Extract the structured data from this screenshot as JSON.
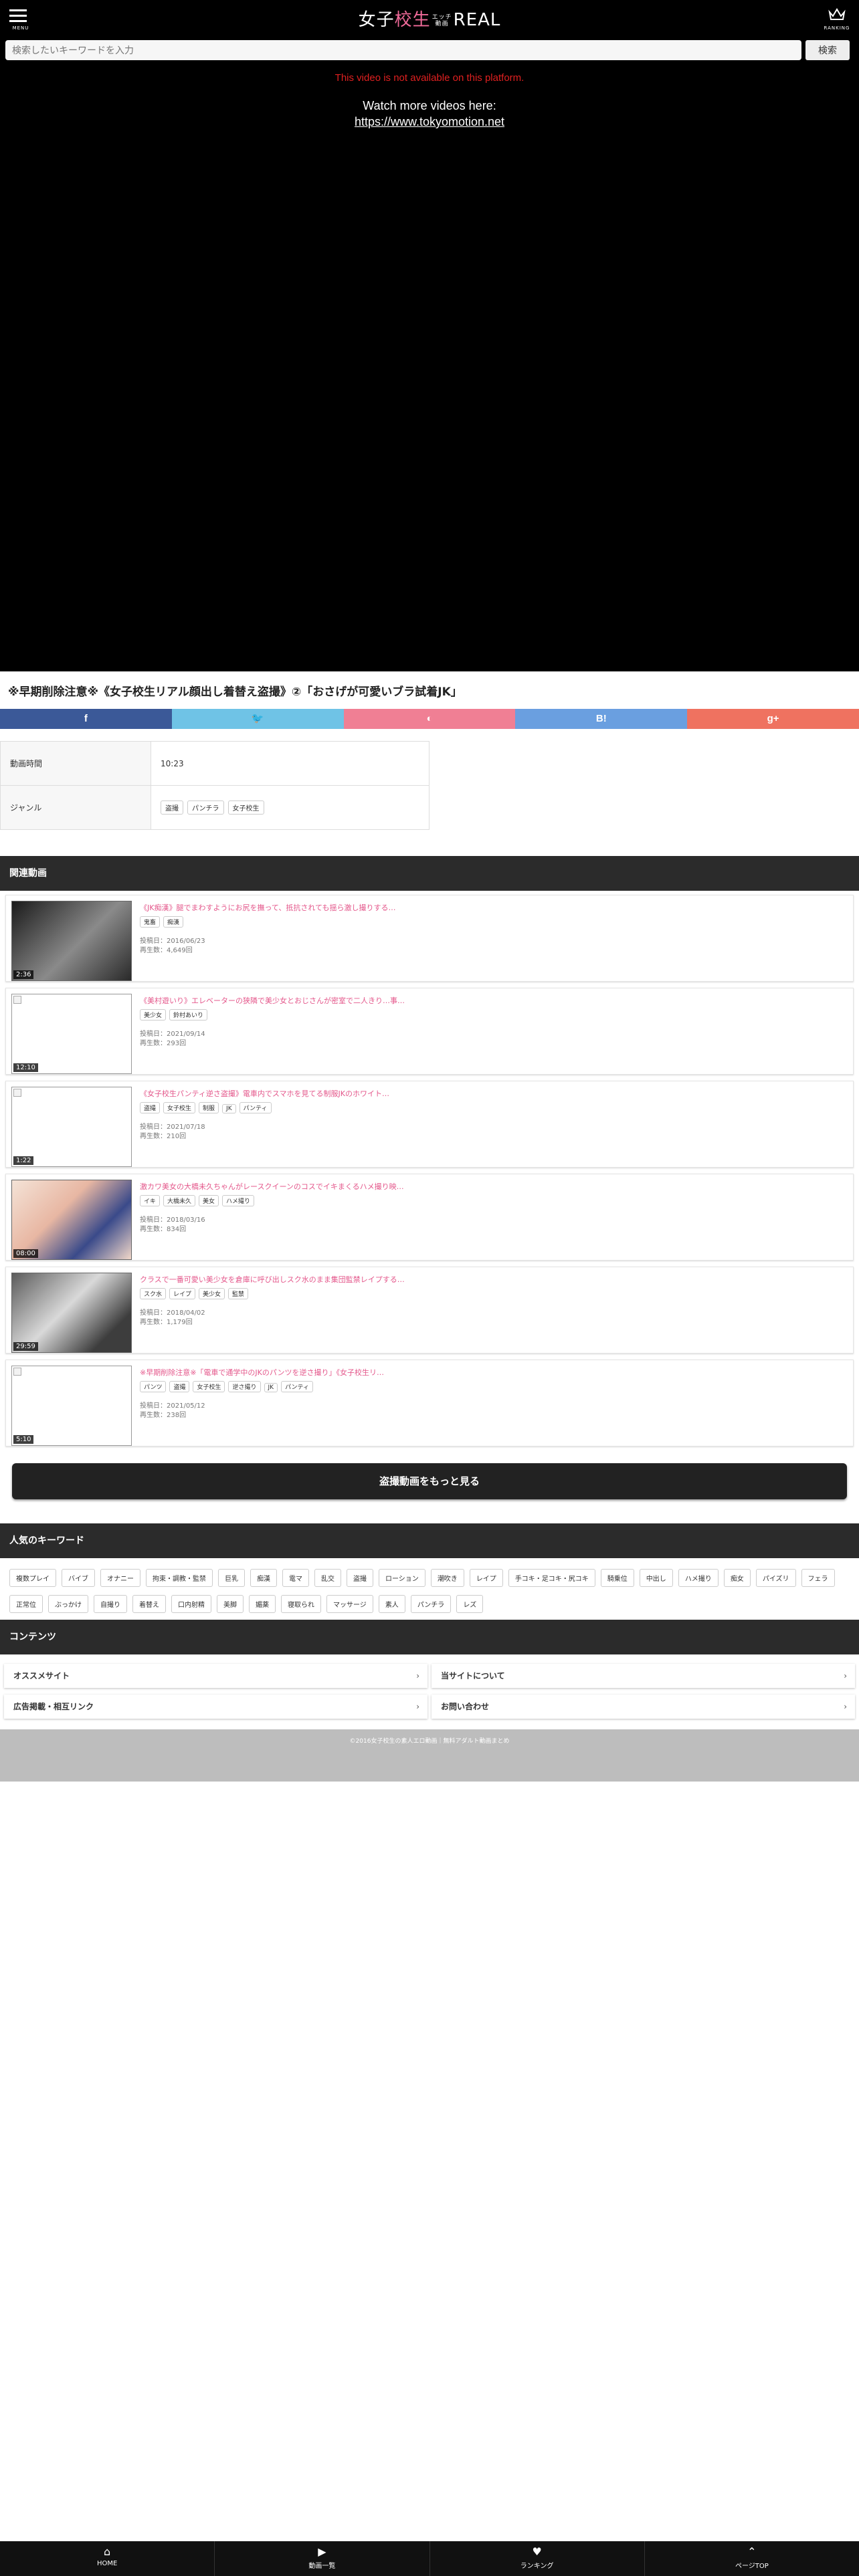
{
  "header": {
    "menu_label": "MENU",
    "logo_left": "女子",
    "logo_pink": "校生",
    "logo_mini_top": "エッチ",
    "logo_mini_bottom": "動画",
    "logo_right": "REAL",
    "ranking_label": "RANKING"
  },
  "search": {
    "placeholder": "検索したいキーワードを入力",
    "button": "検索"
  },
  "player": {
    "error": "This video is not available on this platform.",
    "more_label": "Watch more videos here:",
    "more_url": "https://www.tokyomotion.net"
  },
  "video": {
    "title": "※早期削除注意※《女子校生リアル顔出し着替え盗撮》②「おさげが可愛いブラ試着JK」"
  },
  "share": [
    {
      "icon": "f",
      "color": "#3b5998"
    },
    {
      "icon": "🐦",
      "color": "#6fc3e6"
    },
    {
      "icon": "◐",
      "color": "#f07f94"
    },
    {
      "icon": "B!",
      "color": "#6a9fe0"
    },
    {
      "icon": "g+",
      "color": "#ef7260"
    }
  ],
  "info": {
    "time_label": "動画時間",
    "time_value": "10:23",
    "genre_label": "ジャンル",
    "genres": [
      "盗撮",
      "パンチラ",
      "女子校生"
    ]
  },
  "related": {
    "header": "関連動画",
    "items": [
      {
        "title": "《JK痴漢》腿でまわすようにお尻を撫って、抵抗されても揺ら激し撮りする…",
        "tags": [
          "鬼畜",
          "痴漢"
        ],
        "date": "投稿日：2016/06/23",
        "views": "再生数：4,649回",
        "duration": "2:36"
      },
      {
        "title": "《美村遊いり》エレベーターの狭隣で美少女とおじさんが密室で二人きり…事…",
        "tags": [
          "美少女",
          "鈴村あいり"
        ],
        "date": "投稿日：2021/09/14",
        "views": "再生数：293回",
        "duration": "12:10"
      },
      {
        "title": "《女子校生パンティ逆さ盗撮》電車内でスマホを見てる制服JKのホワイト…",
        "tags": [
          "盗撮",
          "女子校生",
          "制服",
          "JK",
          "パンティ"
        ],
        "date": "投稿日：2021/07/18",
        "views": "再生数：210回",
        "duration": "1:22"
      },
      {
        "title": "激カワ美女の大橋未久ちゃんがレースクイーンのコスでイキまくるハメ撮り映…",
        "tags": [
          "イキ",
          "大橋未久",
          "美女",
          "ハメ撮り"
        ],
        "date": "投稿日：2018/03/16",
        "views": "再生数：834回",
        "duration": "08:00"
      },
      {
        "title": "クラスで一番可愛い美少女を倉庫に呼び出しスク水のまま集団監禁レイプする…",
        "tags": [
          "スク水",
          "レイプ",
          "美少女",
          "監禁"
        ],
        "date": "投稿日：2018/04/02",
        "views": "再生数：1,179回",
        "duration": "29:59"
      },
      {
        "title": "※早期削除注意※「電車で通学中のJKのパンツを逆さ撮り」《女子校生リ…",
        "tags": [
          "パンツ",
          "盗撮",
          "女子校生",
          "逆さ撮り",
          "JK",
          "パンティ"
        ],
        "date": "投稿日：2021/05/12",
        "views": "再生数：238回",
        "duration": "5:10"
      }
    ]
  },
  "more_button": "盗撮動画をもっと見る",
  "keywords": {
    "header": "人気のキーワード",
    "items": [
      "複数プレイ",
      "バイブ",
      "オナニー",
      "拘束・調教・監禁",
      "巨乳",
      "痴漢",
      "電マ",
      "乱交",
      "盗撮",
      "ローション",
      "潮吹き",
      "レイプ",
      "手コキ・足コキ・尻コキ",
      "騎乗位",
      "中出し",
      "ハメ撮り",
      "痴女",
      "パイズリ",
      "フェラ",
      "正常位",
      "ぶっかけ",
      "自撮り",
      "着替え",
      "口内射精",
      "美脚",
      "媚薬",
      "寝取られ",
      "マッサージ",
      "素人",
      "パンチラ",
      "レズ"
    ]
  },
  "contents": {
    "header": "コンテンツ",
    "links": [
      "オススメサイト",
      "当サイトについて",
      "広告掲載・相互リンク",
      "お問い合わせ"
    ]
  },
  "footer": {
    "copyright": "©2016女子校生の素人エロ動画｜無料アダルト動画まとめ"
  },
  "bottom_nav": [
    {
      "icon": "⌂",
      "label": "HOME"
    },
    {
      "icon": "▶",
      "label": "動画一覧"
    },
    {
      "icon": "♥",
      "label": "ランキング"
    },
    {
      "icon": "⌃",
      "label": "ページTOP"
    }
  ]
}
